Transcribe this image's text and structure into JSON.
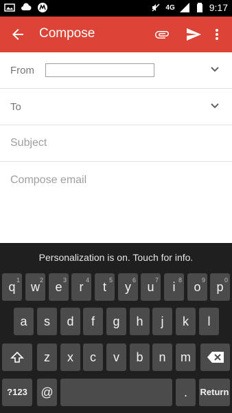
{
  "status_bar": {
    "time": "9:17",
    "network": "4G",
    "left_icons": [
      "image-icon",
      "cloud-icon",
      "motorola-icon"
    ],
    "right_icons": [
      "signal-icon",
      "battery-icon"
    ]
  },
  "app_bar": {
    "title": "Compose",
    "color": "#db4437"
  },
  "compose": {
    "from_label": "From",
    "from_value": "",
    "to_label": "To",
    "subject_placeholder": "Subject",
    "body_placeholder": "Compose email"
  },
  "keyboard": {
    "banner": "Personalization is on. Touch for info.",
    "row1": [
      {
        "label": "q",
        "hint": "1"
      },
      {
        "label": "w",
        "hint": "2"
      },
      {
        "label": "e",
        "hint": "3"
      },
      {
        "label": "r",
        "hint": "4"
      },
      {
        "label": "t",
        "hint": "5"
      },
      {
        "label": "y",
        "hint": "6"
      },
      {
        "label": "u",
        "hint": "7"
      },
      {
        "label": "i",
        "hint": "8"
      },
      {
        "label": "o",
        "hint": "9"
      },
      {
        "label": "p",
        "hint": "0"
      }
    ],
    "row2": [
      "a",
      "s",
      "d",
      "f",
      "g",
      "h",
      "j",
      "k",
      "l"
    ],
    "row3": [
      "z",
      "x",
      "c",
      "v",
      "b",
      "n",
      "m"
    ],
    "symbols_label": "?123",
    "at_label": "@",
    "period_label": ".",
    "return_label": "Return"
  }
}
